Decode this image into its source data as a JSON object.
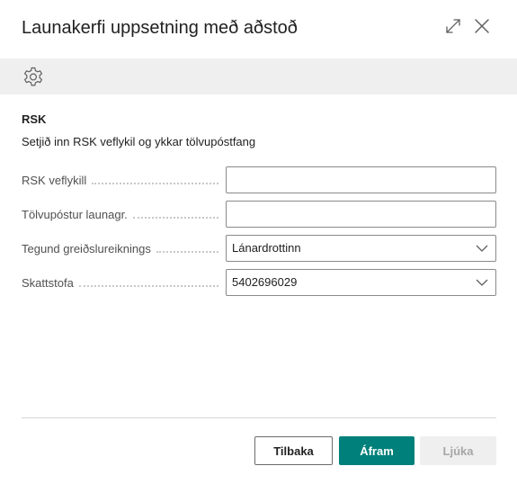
{
  "dialog": {
    "title": "Launakerfi uppsetning með aðstoð",
    "expand_icon": "expand-icon",
    "close_icon": "close-icon"
  },
  "toolbar": {
    "icon": "gear-icon"
  },
  "section": {
    "title": "RSK",
    "description": "Setjið inn RSK veflykil og ykkar tölvupóstfang"
  },
  "fields": [
    {
      "label": "RSK veflykill",
      "value": ""
    },
    {
      "label": "Tölvupóstur launagr.",
      "value": ""
    },
    {
      "label": "Tegund greiðslureiknings",
      "value": "Lánardrottinn"
    },
    {
      "label": "Skattstofa",
      "value": "5402696029"
    }
  ],
  "buttons": {
    "back": "Tilbaka",
    "next": "Áfram",
    "finish": "Ljúka"
  },
  "colors": {
    "accent": "#00807a",
    "toolbar_bg": "#efefef",
    "disabled_text": "#a6a6a6"
  }
}
